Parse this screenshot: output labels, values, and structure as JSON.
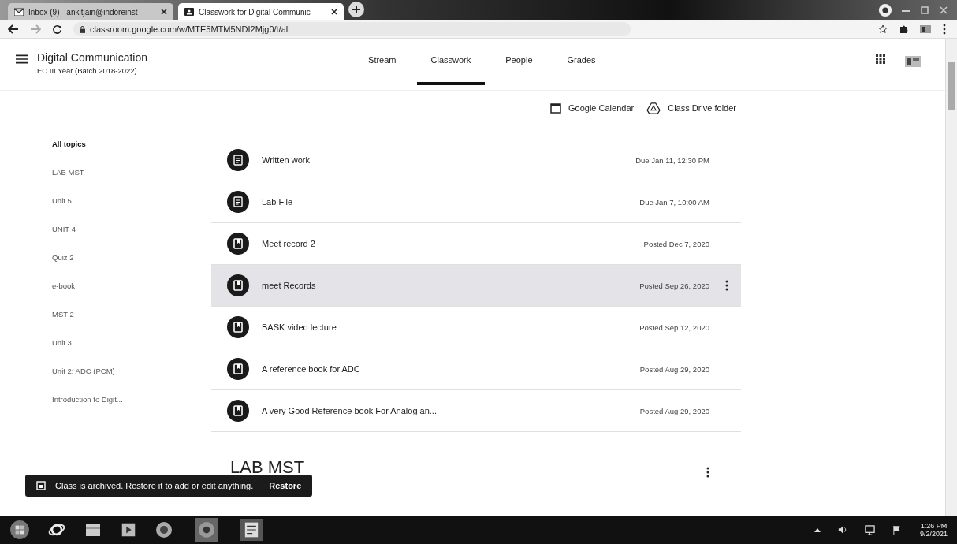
{
  "browser": {
    "tabs": [
      {
        "title": "Inbox (9) - ankitjain@indoreinst",
        "selected": false,
        "kind": "mail"
      },
      {
        "title": "Classwork for Digital Communic",
        "selected": true,
        "kind": "classroom"
      }
    ],
    "url": "classroom.google.com/w/MTE5MTM5NDI2Mjg0/t/all"
  },
  "header": {
    "title": "Digital Communication",
    "subtitle": "EC III Year (Batch 2018-2022)",
    "tabs": [
      {
        "label": "Stream",
        "selected": false
      },
      {
        "label": "Classwork",
        "selected": true
      },
      {
        "label": "People",
        "selected": false
      },
      {
        "label": "Grades",
        "selected": false
      }
    ]
  },
  "links": [
    {
      "label": "Google Calendar",
      "kind": "calendar"
    },
    {
      "label": "Class Drive folder",
      "kind": "drive"
    }
  ],
  "topics": [
    {
      "label": "All topics",
      "selected": true
    },
    {
      "label": "LAB MST",
      "selected": false
    },
    {
      "label": "Unit 5",
      "selected": false
    },
    {
      "label": "UNIT 4",
      "selected": false
    },
    {
      "label": "Quiz 2",
      "selected": false
    },
    {
      "label": "e-book",
      "selected": false
    },
    {
      "label": "MST 2",
      "selected": false
    },
    {
      "label": "Unit 3",
      "selected": false
    },
    {
      "label": "Unit 2: ADC (PCM)",
      "selected": false
    },
    {
      "label": "Introduction to Digit...",
      "selected": false
    }
  ],
  "items": [
    {
      "title": "Written work",
      "date": "Due Jan 11, 12:30 PM",
      "kind": "assignment",
      "selected": false
    },
    {
      "title": "Lab File",
      "date": "Due Jan 7, 10:00 AM",
      "kind": "assignment",
      "selected": false
    },
    {
      "title": "Meet record 2",
      "date": "Posted Dec 7, 2020",
      "kind": "material",
      "selected": false
    },
    {
      "title": "meet Records",
      "date": "Posted Sep 26, 2020",
      "kind": "material",
      "selected": true
    },
    {
      "title": "BASK video lecture",
      "date": "Posted Sep 12, 2020",
      "kind": "material",
      "selected": false
    },
    {
      "title": "A reference book for ADC",
      "date": "Posted Aug 29, 2020",
      "kind": "material",
      "selected": false
    },
    {
      "title": "A very Good Reference book For Analog an...",
      "date": "Posted Aug 29, 2020",
      "kind": "material",
      "selected": false
    }
  ],
  "section_heading": "LAB MST",
  "snackbar": {
    "message": "Class is archived. Restore it to add or edit anything.",
    "action": "Restore"
  },
  "taskbar": {
    "time": "1:26 PM",
    "date": "9/2/2021"
  }
}
